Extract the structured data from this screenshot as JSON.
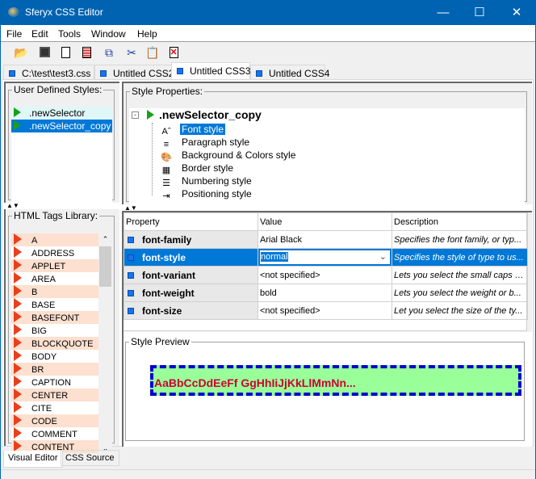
{
  "window": {
    "title": "Sferyx CSS Editor",
    "controls": [
      "minimize",
      "maximize",
      "close"
    ]
  },
  "menu": [
    "File",
    "Edit",
    "Tools",
    "Window",
    "Help"
  ],
  "toolbar": [
    {
      "icon": "open-folder-icon"
    },
    {
      "icon": "save-icon"
    },
    {
      "icon": "new-document-icon"
    },
    {
      "icon": "document-lines-icon"
    },
    {
      "icon": "copy-icon"
    },
    {
      "icon": "cut-icon"
    },
    {
      "icon": "paste-icon"
    },
    {
      "icon": "delete-document-icon"
    }
  ],
  "tabs": [
    {
      "label": "C:\\test\\test3.css"
    },
    {
      "label": "Untitled CSS2"
    },
    {
      "label": "Untitled CSS3",
      "active": true
    },
    {
      "label": "Untitled CSS4"
    }
  ],
  "user_styles": {
    "title": "User Defined Styles:",
    "items": [
      ".newSelector",
      ".newSelector_copy"
    ],
    "selected": ".newSelector_copy"
  },
  "tags_library": {
    "title": "HTML Tags Library:",
    "items": [
      "A",
      "ADDRESS",
      "APPLET",
      "AREA",
      "B",
      "BASE",
      "BASEFONT",
      "BIG",
      "BLOCKQUOTE",
      "BODY",
      "BR",
      "CAPTION",
      "CENTER",
      "CITE",
      "CODE",
      "COMMENT",
      "CONTENT"
    ]
  },
  "style_properties": {
    "title": "Style Properties:",
    "root": ".newSelector_copy",
    "items": [
      {
        "label": "Font style",
        "selected": true
      },
      {
        "label": "Paragraph style"
      },
      {
        "label": "Background & Colors style"
      },
      {
        "label": "Border style"
      },
      {
        "label": "Numbering style"
      },
      {
        "label": "Positioning style"
      }
    ]
  },
  "table": {
    "headers": [
      "Property",
      "Value",
      "Description"
    ],
    "rows": [
      {
        "property": "font-family",
        "value": "Arial Black",
        "description": "Specifies the font family, or typ..."
      },
      {
        "property": "font-style",
        "value": "normal",
        "description": "Specifies the style of type to us...",
        "selected": true
      },
      {
        "property": "font-variant",
        "value": "<not specified>",
        "description": "Lets you select the small caps s..."
      },
      {
        "property": "font-weight",
        "value": "bold",
        "description": "Lets you select the weight or b..."
      },
      {
        "property": "font-size",
        "value": "<not specified>",
        "description": "Let you select the size of the ty..."
      }
    ]
  },
  "preview": {
    "title": "Style Preview",
    "sample": "AaBbCcDdEeFf GgHhIiJjKkLlMmNn...",
    "colors": {
      "text": "#cc0033",
      "background": "#99ff99",
      "border": "#0000cc"
    }
  },
  "bottom_tabs": [
    {
      "label": "Visual Editor",
      "active": true
    },
    {
      "label": "CSS Source"
    }
  ],
  "colors": {
    "titlebar": "#0063b1",
    "selection": "#0078d7"
  }
}
